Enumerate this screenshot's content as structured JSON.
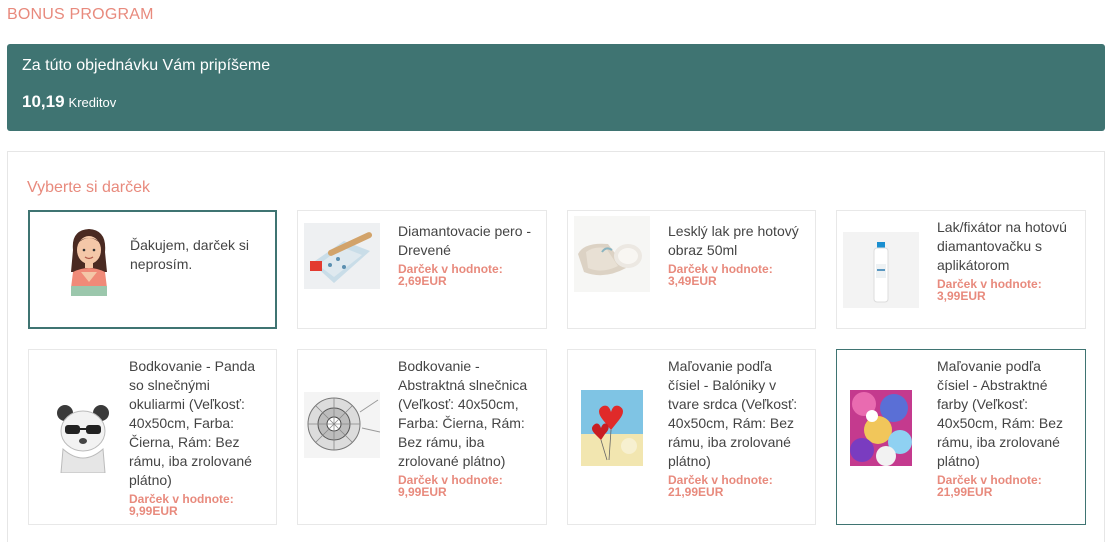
{
  "bonus": {
    "title": "BONUS PROGRAM",
    "credit_text": "Za túto objednávku Vám pripíšeme",
    "credit_amount": "10,19",
    "credit_unit": "Kreditov"
  },
  "gifts": {
    "heading": "Vyberte si darček",
    "price_label": "Darček v hodnote:",
    "items": [
      {
        "name": "Ďakujem, darček si neprosím.",
        "price": "",
        "thumb": "woman-icon"
      },
      {
        "name": "Diamantovacie pero - Drevené",
        "price": "2,69EUR",
        "thumb": "pen-image"
      },
      {
        "name": "Lesklý lak pre hotový obraz 50ml",
        "price": "3,49EUR",
        "thumb": "varnish-image"
      },
      {
        "name": "Lak/fixátor na hotovú diamantovačku s aplikátorom",
        "price": "3,99EUR",
        "thumb": "fixative-image"
      },
      {
        "name": "Bodkovanie - Panda so slnečnými okuliarmi (Veľkosť: 40x50cm, Farba: Čierna, Rám: Bez rámu, iba zrolované plátno)",
        "price": "9,99EUR",
        "thumb": "panda-image"
      },
      {
        "name": "Bodkovanie - Abstraktná slnečnica (Veľkosť: 40x50cm, Farba: Čierna, Rám: Bez rámu, iba zrolované plátno)",
        "price": "9,99EUR",
        "thumb": "sunflower-image"
      },
      {
        "name": "Maľovanie podľa čísiel - Balóniky v tvare srdca (Veľkosť: 40x50cm, Rám: Bez rámu, iba zrolované plátno)",
        "price": "21,99EUR",
        "thumb": "balloons-image"
      },
      {
        "name": "Maľovanie podľa čísiel - Abstraktné farby (Veľkosť: 40x50cm, Rám: Bez rámu, iba zrolované plátno)",
        "price": "21,99EUR",
        "thumb": "abstract-image"
      }
    ]
  },
  "colors": {
    "accent": "#e88a7d",
    "brand": "#3f7472"
  }
}
